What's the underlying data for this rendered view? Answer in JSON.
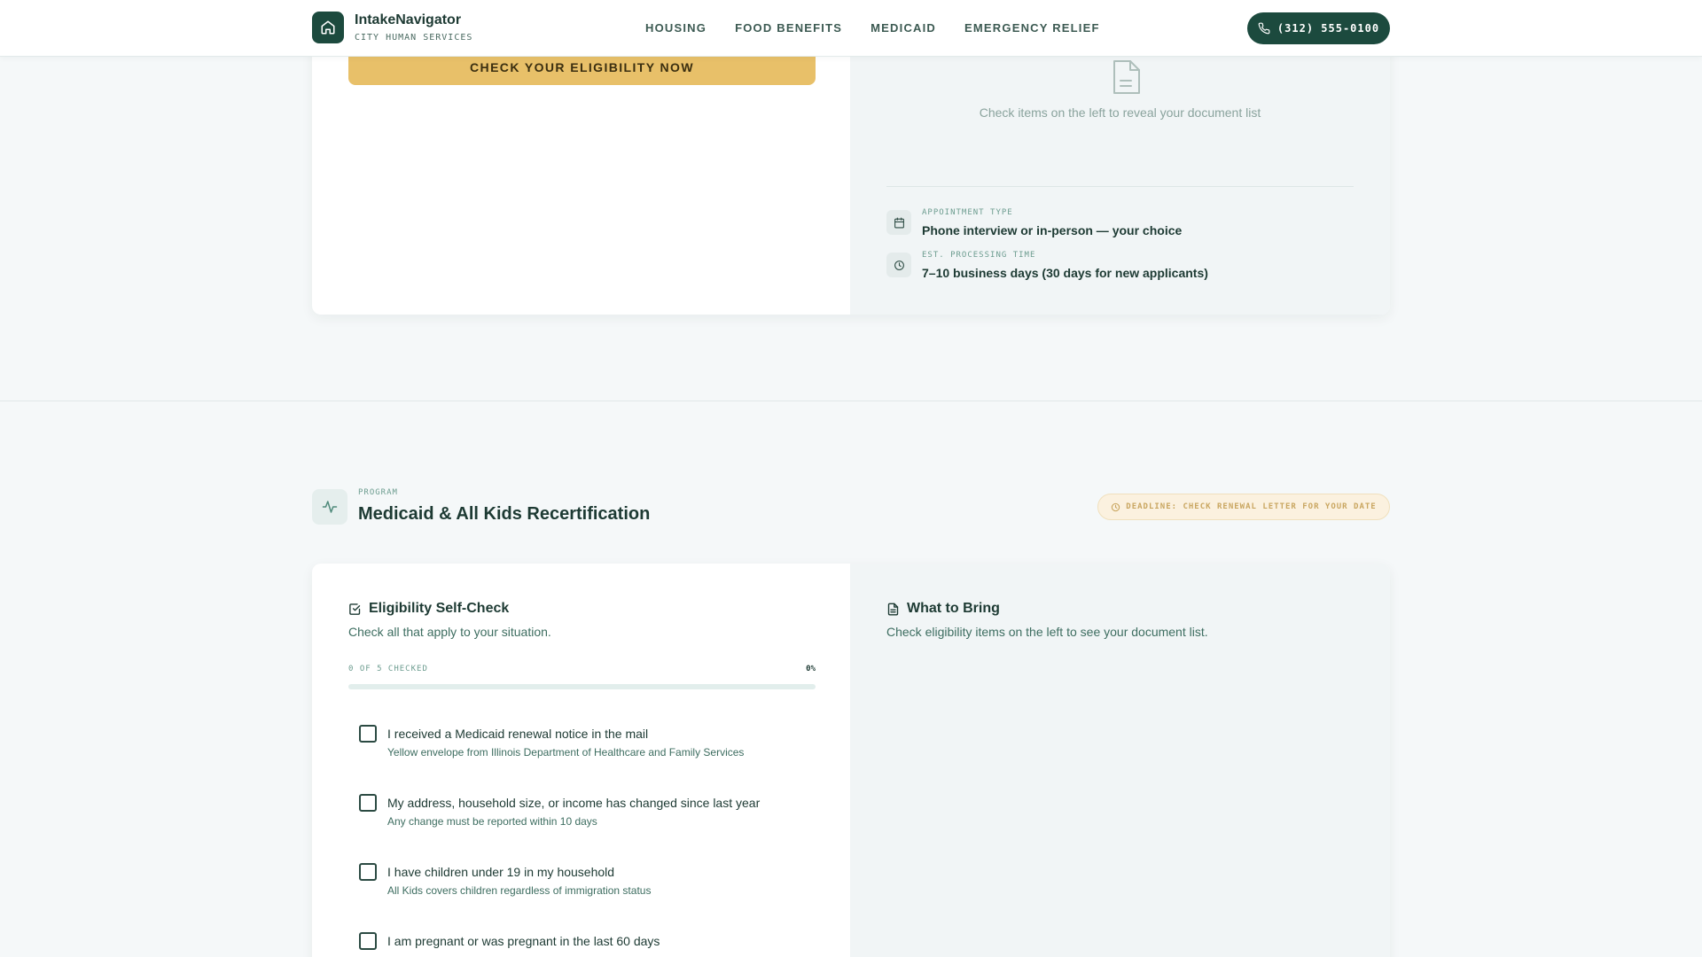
{
  "header": {
    "brand_title": "IntakeNavigator",
    "brand_subtitle": "CITY HUMAN SERVICES",
    "nav": [
      "HOUSING",
      "FOOD BENEFITS",
      "MEDICAID",
      "EMERGENCY RELIEF"
    ],
    "phone": "(312) 555-0100"
  },
  "top_card": {
    "cta_label": "CHECK YOUR ELIGIBILITY NOW",
    "empty_docs_text": "Check items on the left to reveal your document list",
    "appointment_label": "APPOINTMENT TYPE",
    "appointment_value": "Phone interview or in-person — your choice",
    "processing_label": "EST. PROCESSING TIME",
    "processing_value": "7–10 business days (30 days for new applicants)"
  },
  "program": {
    "kicker": "PROGRAM",
    "title": "Medicaid & All Kids Recertification",
    "deadline": "DEADLINE: CHECK RENEWAL LETTER FOR YOUR DATE"
  },
  "eligibility": {
    "title": "Eligibility Self-Check",
    "description": "Check all that apply to your situation.",
    "progress_text": "0 OF 5 CHECKED",
    "progress_pct": "0%",
    "progress_value": 0,
    "items": [
      {
        "label": "I received a Medicaid renewal notice in the mail",
        "sub": "Yellow envelope from Illinois Department of Healthcare and Family Services",
        "checked": false
      },
      {
        "label": "My address, household size, or income has changed since last year",
        "sub": "Any change must be reported within 10 days",
        "checked": false
      },
      {
        "label": "I have children under 19 in my household",
        "sub": "All Kids covers children regardless of immigration status",
        "checked": false
      },
      {
        "label": "I am pregnant or was pregnant in the last 60 days",
        "sub": "",
        "checked": false
      }
    ]
  },
  "what_to_bring": {
    "title": "What to Bring",
    "description": "Check eligibility items on the left to see your document list."
  },
  "colors": {
    "brand": "#1c4a3e",
    "cta": "#e8c069",
    "deadline_bg": "#fbf1df",
    "background": "#f5f8f9"
  },
  "icons": {
    "brand": "home-icon",
    "phone": "phone-icon",
    "empty_docs": "document-icon",
    "appointment": "calendar-icon",
    "processing": "clock-icon",
    "program": "activity-icon",
    "deadline": "clock-icon",
    "eligibility": "checkbox-icon",
    "what_to_bring": "file-text-icon"
  }
}
